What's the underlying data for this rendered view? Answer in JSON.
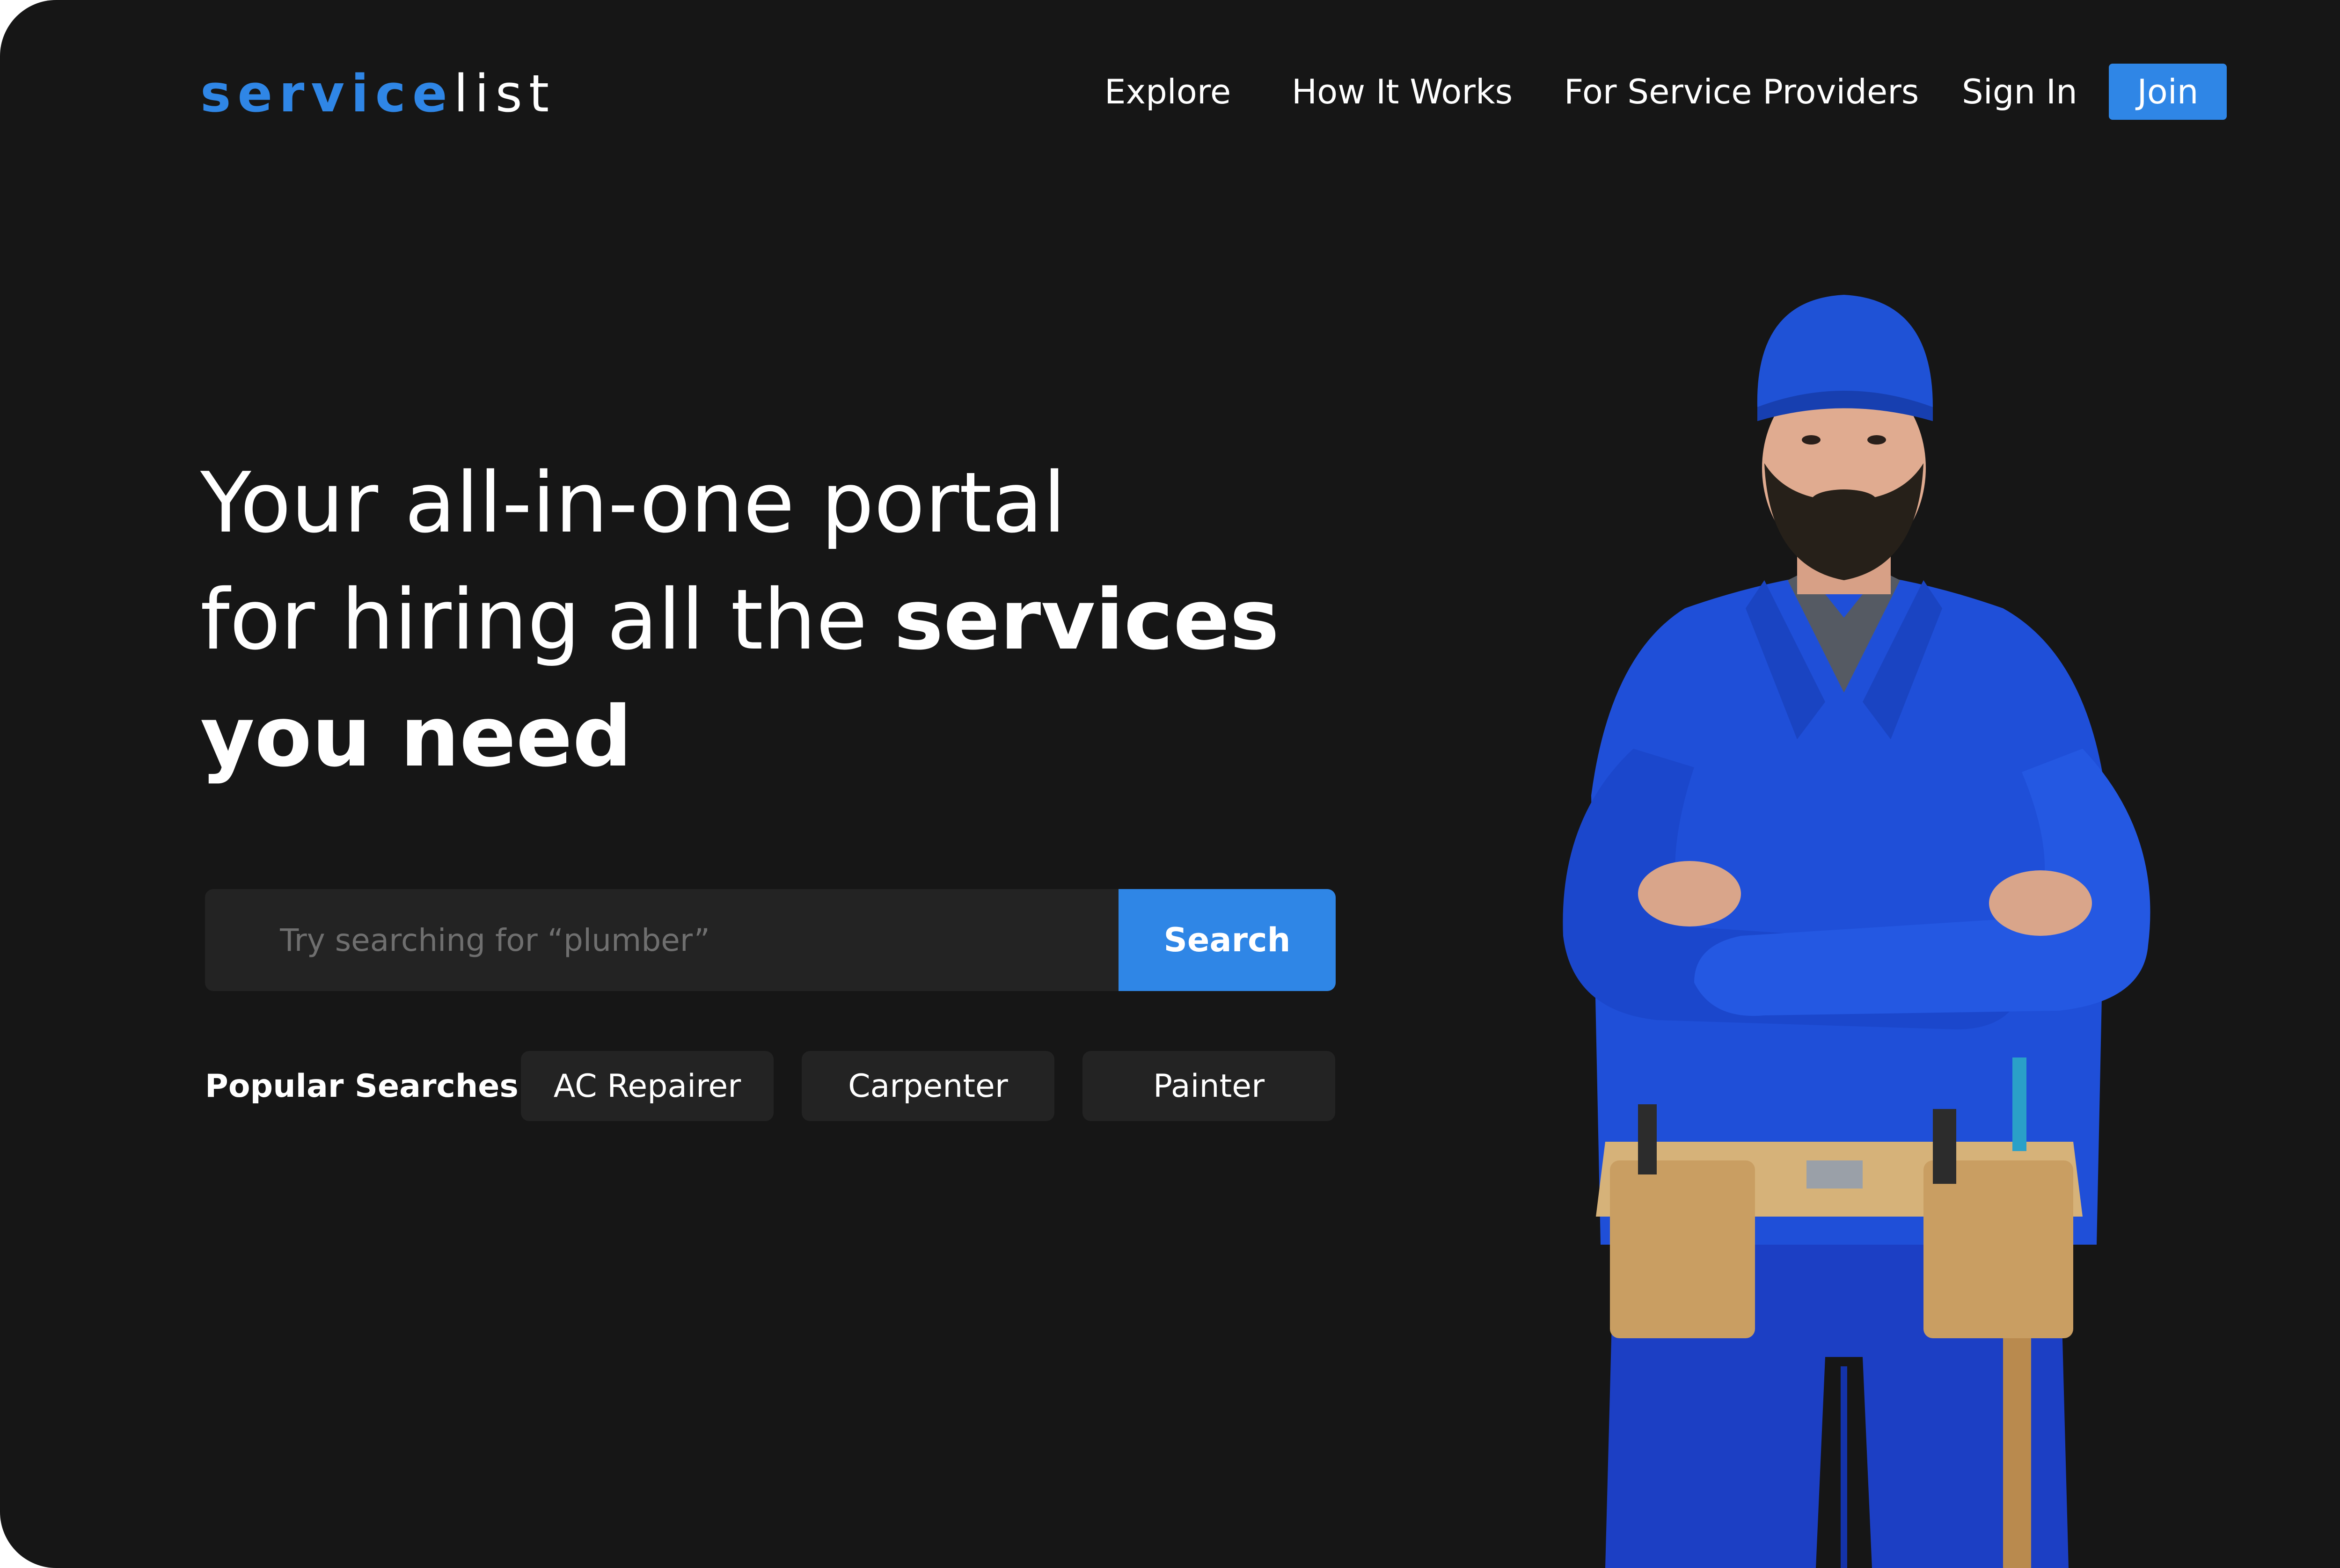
{
  "brand": {
    "part1": "service",
    "part2": "list"
  },
  "nav": {
    "explore": "Explore",
    "how_it_works": "How It Works",
    "for_providers": "For Service Providers",
    "sign_in": "Sign In",
    "join": "Join"
  },
  "hero": {
    "line1": "Your all-in-one portal",
    "line2_regular": "for hiring all the ",
    "line2_bold": "services",
    "line3_bold": "you need"
  },
  "search": {
    "placeholder": "Try searching for “plumber”",
    "value": "",
    "button_label": "Search"
  },
  "popular": {
    "label": "Popular Searches:",
    "items": [
      "AC Repairer",
      "Carpenter",
      "Painter"
    ]
  },
  "colors": {
    "background": "#161616",
    "accent": "#2f86e6",
    "field": "#232323",
    "text": "#ffffff"
  }
}
